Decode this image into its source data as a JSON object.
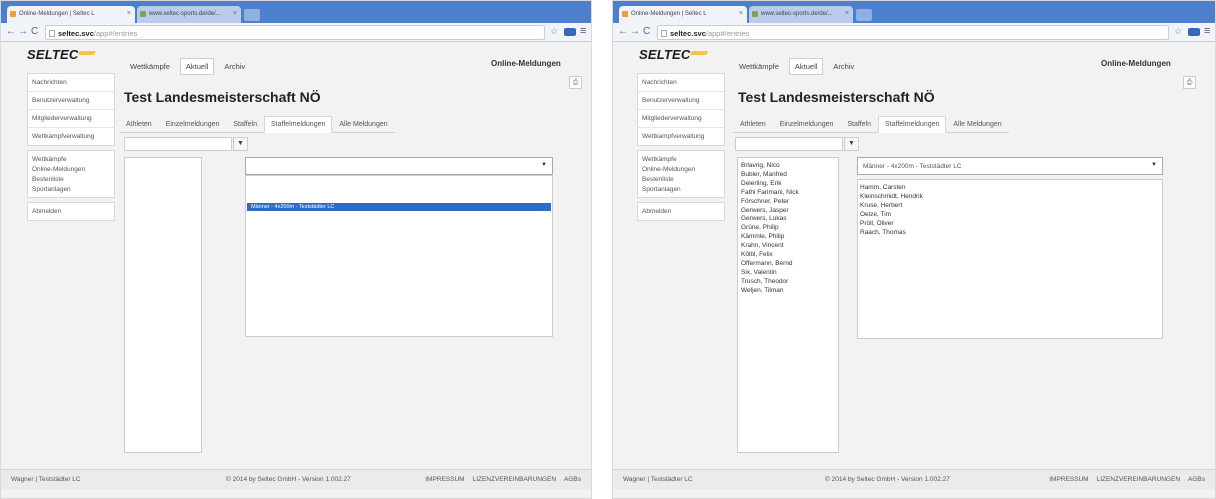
{
  "browser": {
    "tab_active": "Online-Meldungen | Seltec L",
    "tab_second": "www.seltec-sports.de/de/...",
    "tab_close_symbol": "×",
    "url_host": "seltec.svc",
    "url_path": "/app#/entries"
  },
  "app": {
    "logo": "SELTEC",
    "brand": "Online-Meldungen",
    "topnav": [
      "Wettkämpfe",
      "Aktuell",
      "Archiv"
    ]
  },
  "sidebar": {
    "group1": [
      "Nachrichten",
      "Benutzerverwaltung",
      "Mitgliederverwaltung",
      "Wettkampfverwaltung"
    ],
    "group2": [
      "Wettkämpfe",
      "Online-Meldungen",
      "Bestenliste",
      "Sportanlagen"
    ],
    "logout": "Abmelden"
  },
  "main": {
    "title": "Test Landesmeisterschaft NÖ",
    "tabs": [
      "Athleten",
      "Einzelmeldungen",
      "Staffeln",
      "Staffelmeldungen",
      "Alle Meldungen"
    ],
    "filter_icon": "▼",
    "print_icon": "⎙"
  },
  "left_view": {
    "dropdown_value": "",
    "dropdown_option": "Männer - 4x200m - Teststädter LC"
  },
  "right_view": {
    "dropdown_value": "Männer - 4x200m - Teststädter LC",
    "athletes": [
      "Brlavrig, Nico",
      "Bubler, Manfred",
      "Delerling, Erik",
      "Fathi Farimani, Nick",
      "Förschner, Peter",
      "Gerwers, Jasper",
      "Gerwers, Lukas",
      "Grüne, Philip",
      "Kämmle, Philip",
      "Krahn, Vincent",
      "Kölbl, Felix",
      "Offermann, Bernd",
      "Six, Valentin",
      "Trusch, Theodor",
      "Weljen, Tilman"
    ],
    "relay_members": [
      "Hamm, Carsten",
      "Kleinschmidt, Hendrik",
      "Kruse, Herbert",
      "Oelze, Tim",
      "Pröll, Oliver",
      "Raach, Thomas"
    ]
  },
  "footer": {
    "user": "Wagner | Teststädter LC",
    "copyright": "© 2014 by Seltec GmbH - Version 1.002.27",
    "links": [
      "IMPRESSUM",
      "LIZENZVEREINBARUNGEN",
      "AGBs"
    ]
  },
  "colors": {
    "chrome_blue": "#4d7fcf",
    "selection_blue": "#2f6cc9",
    "logo_yellow": "#f4c63a"
  }
}
